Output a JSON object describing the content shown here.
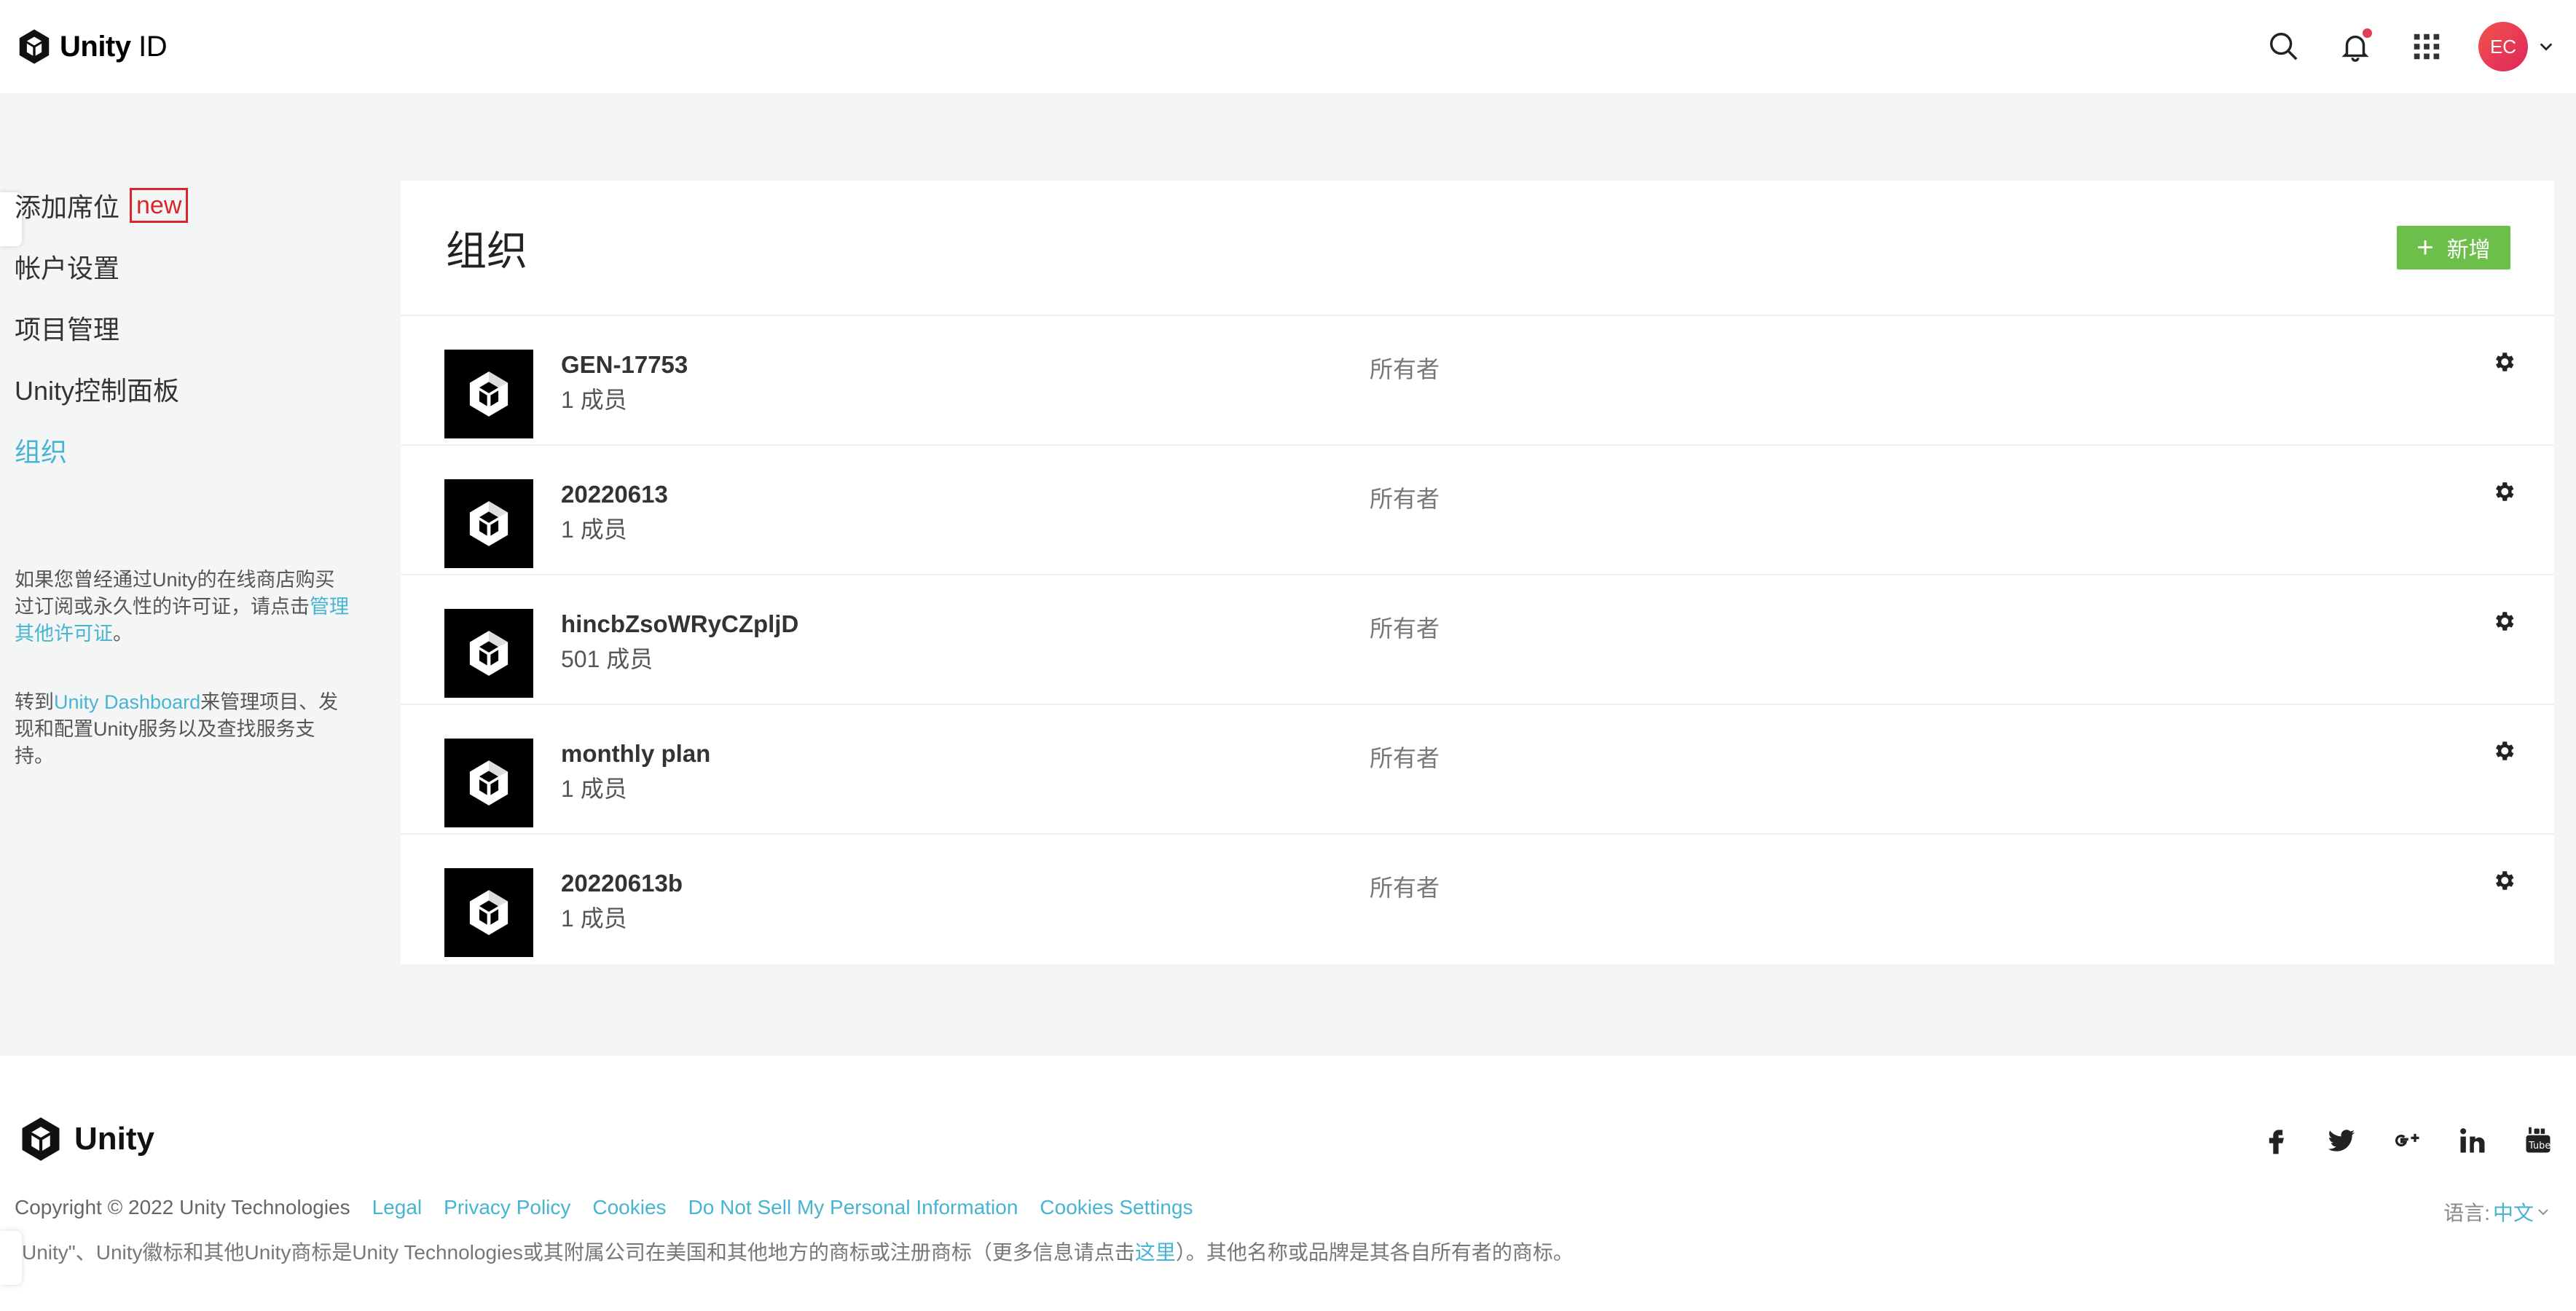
{
  "header": {
    "brand_bold": "Unity",
    "brand_light": " ID",
    "avatar_initials": "EC",
    "icons": [
      "search-icon",
      "bell-icon",
      "apps-grid-icon",
      "chevron-down-icon"
    ]
  },
  "sidebar": {
    "items": [
      {
        "label": "添加席位",
        "badge": "new"
      },
      {
        "label": "帐户设置"
      },
      {
        "label": "项目管理"
      },
      {
        "label": "Unity控制面板"
      },
      {
        "label": "组织",
        "active": true
      }
    ],
    "note1": {
      "before": "如果您曾经通过Unity的在线商店购买过订阅或永久性的许可证，请点击",
      "link": "管理其他许可证",
      "after": "。"
    },
    "note2": {
      "before": "转到",
      "link": "Unity Dashboard",
      "after": "来管理项目、发现和配置Unity服务以及查找服务支持。"
    }
  },
  "main": {
    "title": "组织",
    "add_label": "新增",
    "organizations": [
      {
        "name": "GEN-17753",
        "members": "1 成员",
        "role": "所有者"
      },
      {
        "name": "20220613",
        "members": "1 成员",
        "role": "所有者"
      },
      {
        "name": "hincbZsoWRyCZpljD",
        "members": "501 成员",
        "role": "所有者"
      },
      {
        "name": "monthly plan",
        "members": "1 成员",
        "role": "所有者"
      },
      {
        "name": "20220613b",
        "members": "1 成员",
        "role": "所有者"
      }
    ]
  },
  "footer": {
    "brand": "Unity",
    "copyright": "Copyright © 2022 Unity Technologies",
    "links": [
      "Legal",
      "Privacy Policy",
      "Cookies",
      "Do Not Sell My Personal Information",
      "Cookies Settings"
    ],
    "language_label": "语言:",
    "language_value": "中文",
    "trademark_before": "Unity\"、Unity徽标和其他Unity商标是Unity Technologies或其附属公司在美国和其他地方的商标或注册商标（更多信息请点击",
    "trademark_link": "这里",
    "trademark_after": "）。其他名称或品牌是其各自所有者的商标。",
    "socials": [
      "facebook-icon",
      "twitter-icon",
      "google-plus-icon",
      "linkedin-icon",
      "youtube-icon"
    ]
  },
  "colors": {
    "accent": "#47b4d2",
    "add_button": "#6dbf4b",
    "badge_red": "#d9262d",
    "background": "#f4f6f6"
  }
}
